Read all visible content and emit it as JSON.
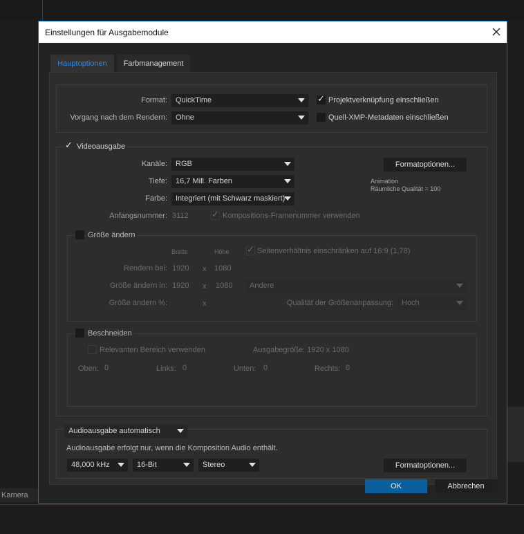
{
  "background": {
    "camera_label": "Kamera"
  },
  "dialog": {
    "title": "Einstellungen für Ausgabemodule",
    "tabs": [
      {
        "label": "Hauptoptionen",
        "active": true
      },
      {
        "label": "Farbmanagement",
        "active": false
      }
    ],
    "format": {
      "format_label": "Format:",
      "format_value": "QuickTime",
      "post_render_label": "Vorgang nach dem Rendern:",
      "post_render_value": "Ohne",
      "include_project_link": {
        "label": "Projektverknüpfung einschließen",
        "checked": true
      },
      "include_xmp": {
        "label": "Quell-XMP-Metadaten einschließen",
        "checked": false
      }
    },
    "video": {
      "enabled_label": "Videoausgabe",
      "enabled": true,
      "channels_label": "Kanäle:",
      "channels_value": "RGB",
      "depth_label": "Tiefe:",
      "depth_value": "16,7 Mill. Farben",
      "color_label": "Farbe:",
      "color_value": "Integriert (mit Schwarz maskiert)",
      "start_number_label": "Anfangsnummer:",
      "start_number_value": "3112",
      "use_comp_frame_label": "Kompositions-Framenummer verwenden",
      "format_options_button": "Formatoptionen...",
      "codec_info_line1": "Animation",
      "codec_info_line2": "Räumliche Qualität = 100"
    },
    "resize": {
      "label": "Größe ändern",
      "enabled": false,
      "width_header": "Breite",
      "height_header": "Höhe",
      "lock_aspect_label": "Seitenverhältnis einschränken auf 16:9 (1,78)",
      "render_at_label": "Rendern bei:",
      "render_w": "1920",
      "render_h": "1080",
      "resize_to_label": "Größe ändern in:",
      "resize_w": "1920",
      "resize_h": "1080",
      "x": "x",
      "preset_value": "Andere",
      "resize_pct_label": "Größe ändern %:",
      "quality_label": "Qualität der Größenanpassung:",
      "quality_value": "Hoch"
    },
    "crop": {
      "label": "Beschneiden",
      "enabled": false,
      "use_roi_label": "Relevanten Bereich verwenden",
      "output_size_label": "Ausgabegröße: 1920 x 1080",
      "top_label": "Oben:",
      "top_value": "0",
      "left_label": "Links:",
      "left_value": "0",
      "bottom_label": "Unten:",
      "bottom_value": "0",
      "right_label": "Rechts:",
      "right_value": "0"
    },
    "audio": {
      "mode_value": "Audioausgabe automatisch",
      "note": "Audioausgabe erfolgt nur, wenn die Komposition Audio enthält.",
      "sample_rate": "48,000 kHz",
      "bit_depth": "16-Bit",
      "channels": "Stereo",
      "format_options_button": "Formatoptionen..."
    },
    "ok_button": "OK",
    "cancel_button": "Abbrechen"
  },
  "colors": {
    "accent": "#2d8ceb",
    "primary_button": "#0b5f9c",
    "dialog_border": "#0e6fb8"
  }
}
